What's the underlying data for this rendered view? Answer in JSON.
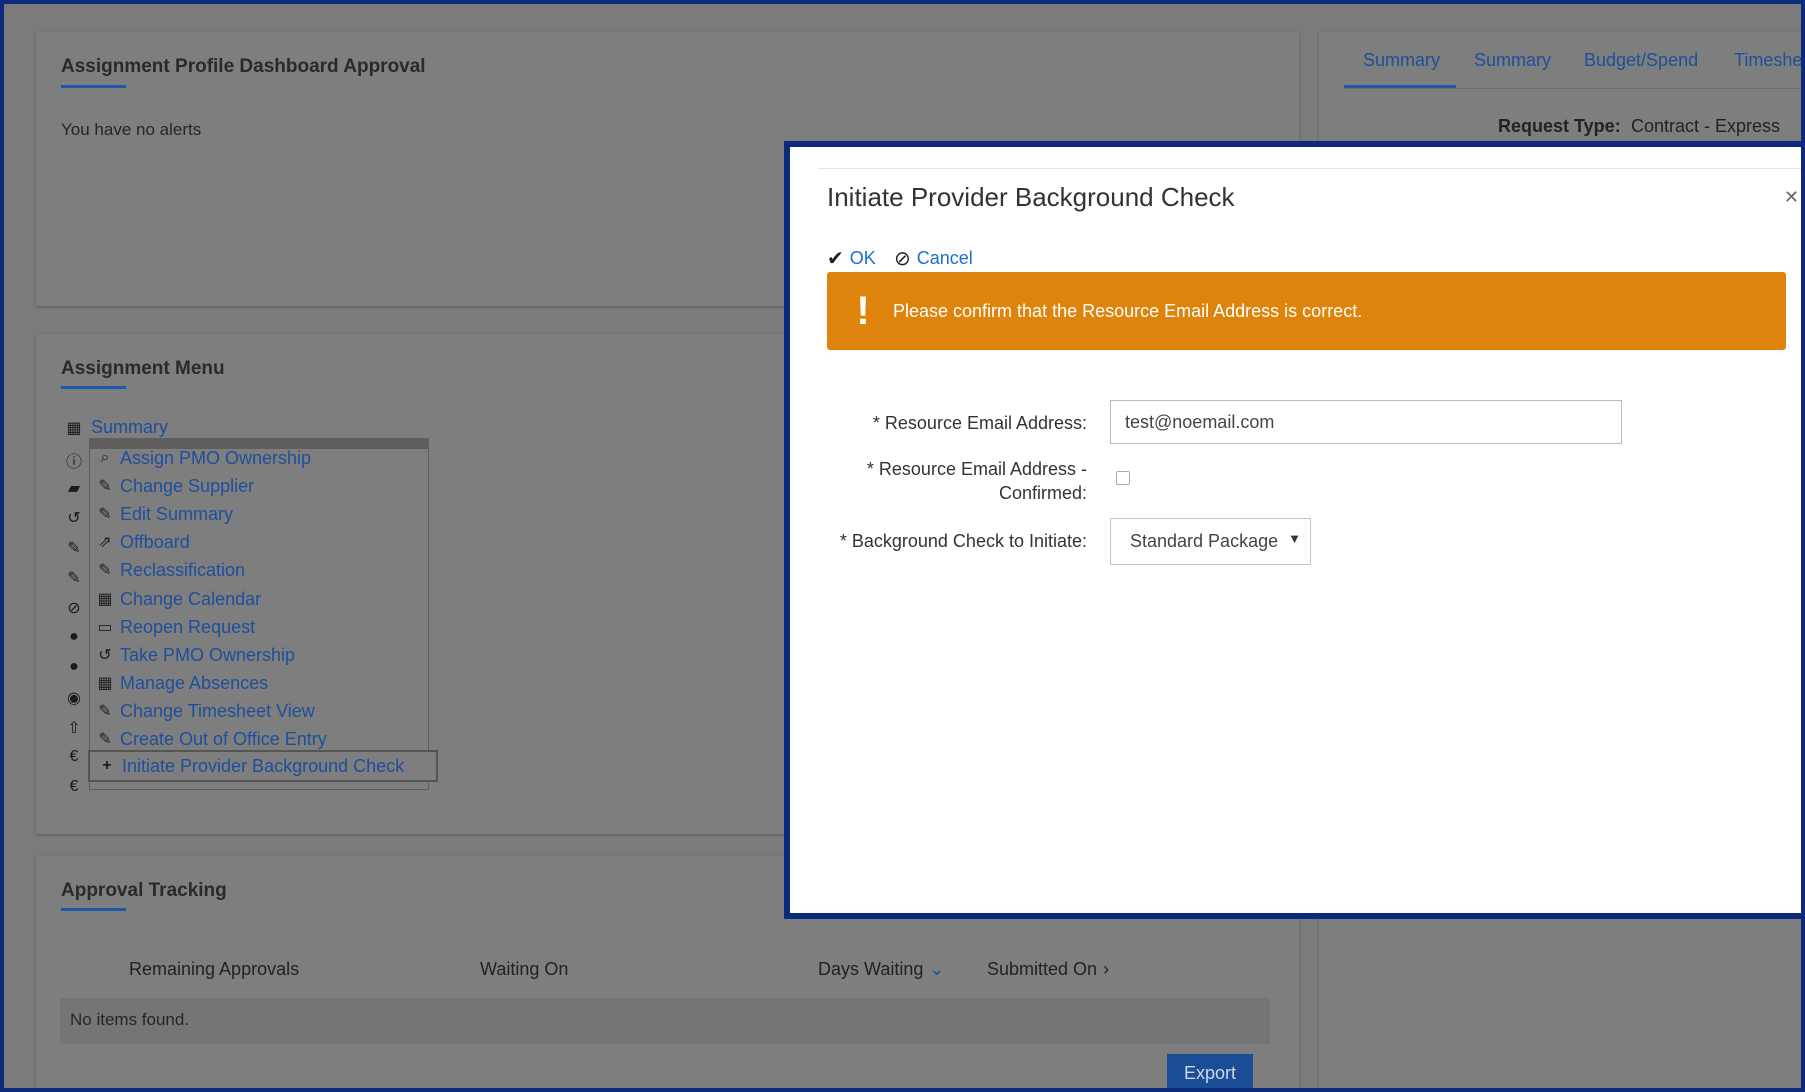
{
  "alerts_panel": {
    "title": "Assignment Profile Dashboard Approval",
    "message": "You have no alerts"
  },
  "assignment_menu": {
    "title": "Assignment Menu",
    "first_item": "Summary",
    "dropdown_items": [
      {
        "label": "Assign PMO Ownership",
        "icon": "search-icon"
      },
      {
        "label": "Change Supplier",
        "icon": "pencil-icon"
      },
      {
        "label": "Edit Summary",
        "icon": "pencil-icon"
      },
      {
        "label": "Offboard",
        "icon": "share-icon"
      },
      {
        "label": "Reclassification",
        "icon": "pencil-icon"
      },
      {
        "label": "Change Calendar",
        "icon": "calendar-icon"
      },
      {
        "label": "Reopen Request",
        "icon": "folder-open-icon"
      },
      {
        "label": "Take PMO Ownership",
        "icon": "undo-icon"
      },
      {
        "label": "Manage Absences",
        "icon": "calendar-icon"
      },
      {
        "label": "Change Timesheet View",
        "icon": "pencil-icon"
      },
      {
        "label": "Create Out of Office Entry",
        "icon": "pencil-icon"
      }
    ],
    "highlighted_item": {
      "label": "Initiate Provider Background Check",
      "icon": "plus-icon"
    }
  },
  "right_panel": {
    "tabs": [
      "Summary",
      "Summary",
      "Budget/Spend",
      "Timeshe"
    ],
    "request_type_label": "Request Type:",
    "request_type_value": "Contract - Express"
  },
  "approval_tracking": {
    "title": "Approval Tracking",
    "columns": {
      "remaining": "Remaining Approvals",
      "waiting_on": "Waiting On",
      "days_waiting": "Days Waiting",
      "submitted_on": "Submitted On"
    },
    "empty_message": "No items found.",
    "export_label": "Export"
  },
  "modal": {
    "title": "Initiate Provider Background Check",
    "ok_label": "OK",
    "cancel_label": "Cancel",
    "alert_message": "Please confirm that the Resource Email Address is correct.",
    "fields": {
      "email_label": "* Resource Email Address:",
      "email_value": "test@noemail.com",
      "confirmed_label_line1": "* Resource Email Address -",
      "confirmed_label_line2": "Confirmed:",
      "background_check_label": "* Background Check to Initiate:",
      "background_check_value": "Standard Package"
    }
  },
  "colors": {
    "frame": "#0b2a7a",
    "link": "#1a6fd6",
    "alert": "#de840c",
    "overlay": "#7b7b7b"
  }
}
